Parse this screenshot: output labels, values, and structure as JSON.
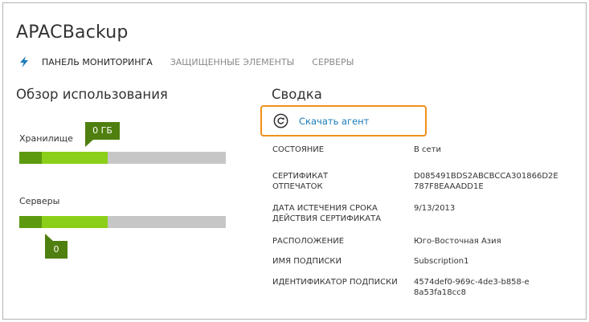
{
  "app": {
    "title": "APACBackup"
  },
  "nav": {
    "icon": "lightning-icon",
    "tabs": [
      {
        "label": "ПАНЕЛЬ МОНИТОРИНГА",
        "active": true
      },
      {
        "label": "ЗАЩИЩЕННЫЕ ЭЛЕМЕНТЫ",
        "active": false
      },
      {
        "label": "СЕРВЕРЫ",
        "active": false
      }
    ]
  },
  "usage": {
    "title": "Обзор использования",
    "storage": {
      "label": "Хранилище",
      "callout": "0 ГБ"
    },
    "servers": {
      "label": "Серверы",
      "callout": "0"
    }
  },
  "summary": {
    "title": "Сводка",
    "download_label": "Скачать агент",
    "download_icon": "refresh-circle-icon",
    "properties": [
      {
        "label": "СОСТОЯНИЕ",
        "value": "В сети"
      },
      {
        "label": "СЕРТИФИКАТ ОТПЕЧАТОК",
        "value": "D085491BDS2ABCBCCA301866D2E787F8EAAADD1E"
      },
      {
        "label": "ДАТА ИСТЕЧЕНИЯ СРОКА ДЕЙСТВИЯ СЕРТИФИКАТА",
        "value": "9/13/2013"
      },
      {
        "label": "РАСПОЛОЖЕНИЕ",
        "value": "Юго-Восточная Азия"
      },
      {
        "label": "ИМЯ ПОДПИСКИ",
        "value": "Subscription1"
      },
      {
        "label": "ИДЕНТИФИКАТОР ПОДПИСКИ",
        "value": "4574def0-969c-4de3-b858-e8a53fa18cc8"
      }
    ]
  },
  "colors": {
    "accent_orange": "#f0901b",
    "link_blue": "#1a7bb8",
    "bar_dark_green": "#5d9a10",
    "bar_light_green": "#8ccf1a",
    "bar_track": "#c6c6c6",
    "callout_green": "#4f7f0e"
  }
}
